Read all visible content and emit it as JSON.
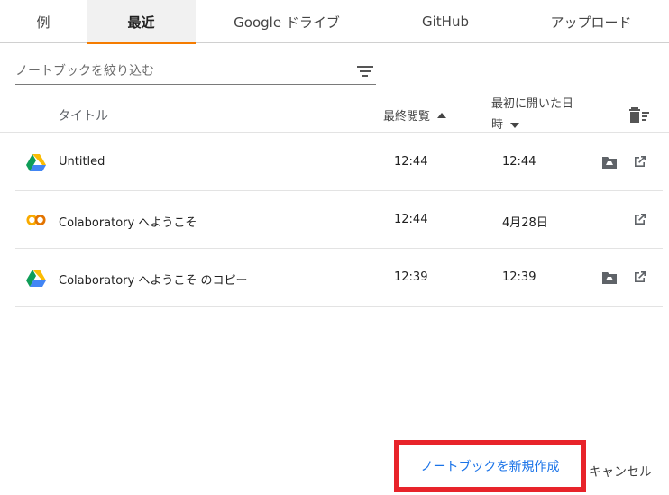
{
  "tabs": [
    {
      "label": "例"
    },
    {
      "label": "最近"
    },
    {
      "label": "Google ドライブ"
    },
    {
      "label": "GitHub"
    },
    {
      "label": "アップロード"
    }
  ],
  "active_tab": "最近",
  "filter": {
    "placeholder": "ノートブックを絞り込む",
    "value": ""
  },
  "table": {
    "headers": {
      "title": "タイトル",
      "last_viewed": "最終閲覧",
      "first_opened_line1": "最初に開いた日",
      "first_opened_line2": "時"
    },
    "rows": [
      {
        "icon": "google-drive-icon",
        "name": "Untitled",
        "last_viewed": "12:44",
        "first_opened": "12:44",
        "has_drive": true
      },
      {
        "icon": "colab-icon",
        "name": "Colaboratory へようこそ",
        "last_viewed": "12:44",
        "first_opened": "4月28日",
        "has_drive": false
      },
      {
        "icon": "google-drive-icon",
        "name": "Colaboratory へようこそ のコピー",
        "last_viewed": "12:39",
        "first_opened": "12:39",
        "has_drive": true
      }
    ]
  },
  "footer": {
    "new_notebook": "ノートブックを新規作成",
    "cancel": "キャンセル"
  },
  "colors": {
    "accent": "#f57c00",
    "link": "#1a73e8",
    "highlight_box": "#e8232a"
  }
}
